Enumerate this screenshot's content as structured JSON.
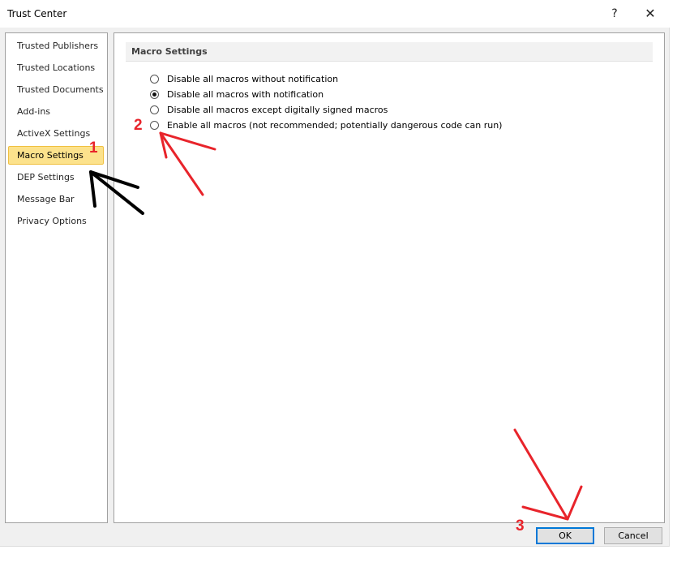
{
  "window": {
    "title": "Trust Center",
    "help_glyph": "?",
    "close_glyph": "✕"
  },
  "nav": {
    "items": [
      {
        "label": "Trusted Publishers"
      },
      {
        "label": "Trusted Locations"
      },
      {
        "label": "Trusted Documents"
      },
      {
        "label": "Add-ins"
      },
      {
        "label": "ActiveX Settings"
      },
      {
        "label": "Macro Settings",
        "selected": true
      },
      {
        "label": "DEP Settings"
      },
      {
        "label": "Message Bar"
      },
      {
        "label": "Privacy Options"
      }
    ]
  },
  "macro_settings": {
    "section_title": "Macro Settings",
    "options": [
      {
        "label": "Disable all macros without notification",
        "checked": false
      },
      {
        "label": "Disable all macros with notification",
        "checked": true
      },
      {
        "label": "Disable all macros except digitally signed macros",
        "checked": false
      },
      {
        "label": "Enable all macros (not recommended; potentially dangerous code can run)",
        "checked": false
      }
    ]
  },
  "buttons": {
    "ok": "OK",
    "cancel": "Cancel"
  },
  "annotations": {
    "step1": "1",
    "step2": "2",
    "step3": "3",
    "accent_red": "#e8242b",
    "arrow_black": "#000000"
  }
}
